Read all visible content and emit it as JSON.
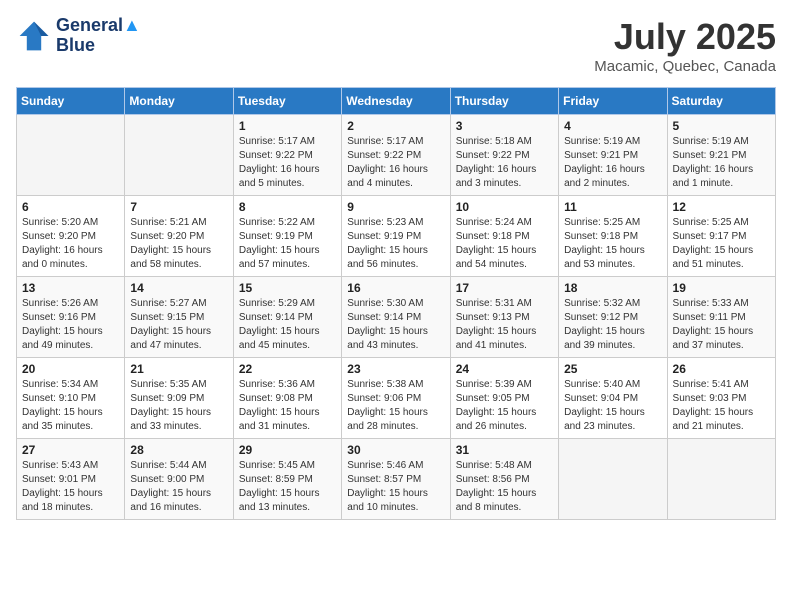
{
  "header": {
    "logo_line1": "General",
    "logo_line2": "Blue",
    "month": "July 2025",
    "location": "Macamic, Quebec, Canada"
  },
  "weekdays": [
    "Sunday",
    "Monday",
    "Tuesday",
    "Wednesday",
    "Thursday",
    "Friday",
    "Saturday"
  ],
  "weeks": [
    [
      {
        "day": "",
        "info": ""
      },
      {
        "day": "",
        "info": ""
      },
      {
        "day": "1",
        "info": "Sunrise: 5:17 AM\nSunset: 9:22 PM\nDaylight: 16 hours and 5 minutes."
      },
      {
        "day": "2",
        "info": "Sunrise: 5:17 AM\nSunset: 9:22 PM\nDaylight: 16 hours and 4 minutes."
      },
      {
        "day": "3",
        "info": "Sunrise: 5:18 AM\nSunset: 9:22 PM\nDaylight: 16 hours and 3 minutes."
      },
      {
        "day": "4",
        "info": "Sunrise: 5:19 AM\nSunset: 9:21 PM\nDaylight: 16 hours and 2 minutes."
      },
      {
        "day": "5",
        "info": "Sunrise: 5:19 AM\nSunset: 9:21 PM\nDaylight: 16 hours and 1 minute."
      }
    ],
    [
      {
        "day": "6",
        "info": "Sunrise: 5:20 AM\nSunset: 9:20 PM\nDaylight: 16 hours and 0 minutes."
      },
      {
        "day": "7",
        "info": "Sunrise: 5:21 AM\nSunset: 9:20 PM\nDaylight: 15 hours and 58 minutes."
      },
      {
        "day": "8",
        "info": "Sunrise: 5:22 AM\nSunset: 9:19 PM\nDaylight: 15 hours and 57 minutes."
      },
      {
        "day": "9",
        "info": "Sunrise: 5:23 AM\nSunset: 9:19 PM\nDaylight: 15 hours and 56 minutes."
      },
      {
        "day": "10",
        "info": "Sunrise: 5:24 AM\nSunset: 9:18 PM\nDaylight: 15 hours and 54 minutes."
      },
      {
        "day": "11",
        "info": "Sunrise: 5:25 AM\nSunset: 9:18 PM\nDaylight: 15 hours and 53 minutes."
      },
      {
        "day": "12",
        "info": "Sunrise: 5:25 AM\nSunset: 9:17 PM\nDaylight: 15 hours and 51 minutes."
      }
    ],
    [
      {
        "day": "13",
        "info": "Sunrise: 5:26 AM\nSunset: 9:16 PM\nDaylight: 15 hours and 49 minutes."
      },
      {
        "day": "14",
        "info": "Sunrise: 5:27 AM\nSunset: 9:15 PM\nDaylight: 15 hours and 47 minutes."
      },
      {
        "day": "15",
        "info": "Sunrise: 5:29 AM\nSunset: 9:14 PM\nDaylight: 15 hours and 45 minutes."
      },
      {
        "day": "16",
        "info": "Sunrise: 5:30 AM\nSunset: 9:14 PM\nDaylight: 15 hours and 43 minutes."
      },
      {
        "day": "17",
        "info": "Sunrise: 5:31 AM\nSunset: 9:13 PM\nDaylight: 15 hours and 41 minutes."
      },
      {
        "day": "18",
        "info": "Sunrise: 5:32 AM\nSunset: 9:12 PM\nDaylight: 15 hours and 39 minutes."
      },
      {
        "day": "19",
        "info": "Sunrise: 5:33 AM\nSunset: 9:11 PM\nDaylight: 15 hours and 37 minutes."
      }
    ],
    [
      {
        "day": "20",
        "info": "Sunrise: 5:34 AM\nSunset: 9:10 PM\nDaylight: 15 hours and 35 minutes."
      },
      {
        "day": "21",
        "info": "Sunrise: 5:35 AM\nSunset: 9:09 PM\nDaylight: 15 hours and 33 minutes."
      },
      {
        "day": "22",
        "info": "Sunrise: 5:36 AM\nSunset: 9:08 PM\nDaylight: 15 hours and 31 minutes."
      },
      {
        "day": "23",
        "info": "Sunrise: 5:38 AM\nSunset: 9:06 PM\nDaylight: 15 hours and 28 minutes."
      },
      {
        "day": "24",
        "info": "Sunrise: 5:39 AM\nSunset: 9:05 PM\nDaylight: 15 hours and 26 minutes."
      },
      {
        "day": "25",
        "info": "Sunrise: 5:40 AM\nSunset: 9:04 PM\nDaylight: 15 hours and 23 minutes."
      },
      {
        "day": "26",
        "info": "Sunrise: 5:41 AM\nSunset: 9:03 PM\nDaylight: 15 hours and 21 minutes."
      }
    ],
    [
      {
        "day": "27",
        "info": "Sunrise: 5:43 AM\nSunset: 9:01 PM\nDaylight: 15 hours and 18 minutes."
      },
      {
        "day": "28",
        "info": "Sunrise: 5:44 AM\nSunset: 9:00 PM\nDaylight: 15 hours and 16 minutes."
      },
      {
        "day": "29",
        "info": "Sunrise: 5:45 AM\nSunset: 8:59 PM\nDaylight: 15 hours and 13 minutes."
      },
      {
        "day": "30",
        "info": "Sunrise: 5:46 AM\nSunset: 8:57 PM\nDaylight: 15 hours and 10 minutes."
      },
      {
        "day": "31",
        "info": "Sunrise: 5:48 AM\nSunset: 8:56 PM\nDaylight: 15 hours and 8 minutes."
      },
      {
        "day": "",
        "info": ""
      },
      {
        "day": "",
        "info": ""
      }
    ]
  ]
}
